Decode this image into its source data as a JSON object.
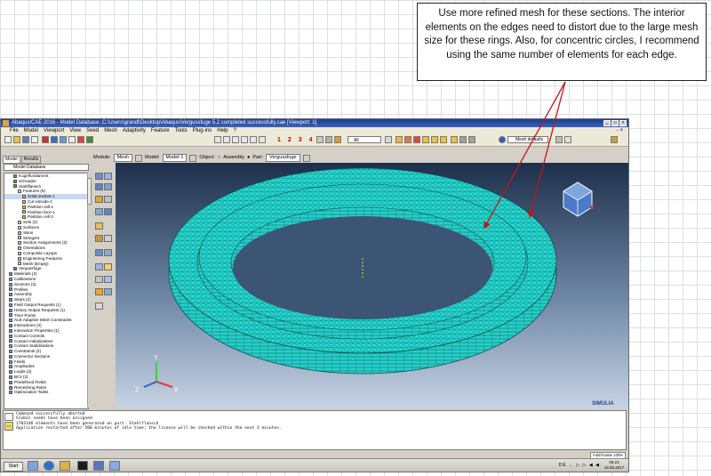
{
  "callout": {
    "text": "Use more refined mesh for these sections.  The interior elements on the edges need to distort due to the large mesh size for these rings.  Also, for concentric circles, I recommend using the same number of elements for each edge."
  },
  "window": {
    "title": "Abaqus/CAE 2016 - Model Database: C:\\Users\\grandl\\Desktop\\Abaqus\\Vergussfuge 5.2 completed successfully.cae [Viewport: 1]",
    "menu": [
      "File",
      "Model",
      "Viewport",
      "View",
      "Seed",
      "Mesh",
      "Adaptivity",
      "Feature",
      "Tools",
      "Plug-ins",
      "Help",
      "?"
    ],
    "right_glyphs": "- ×"
  },
  "toolbar": {
    "view_numbers": [
      "1",
      "2",
      "3",
      "4"
    ],
    "zoom_value": "All",
    "mesh_defaults": "Mesh defaults"
  },
  "tabs": [
    "Model",
    "Results"
  ],
  "module_bar": {
    "module_label": "Module:",
    "module_value": "Mesh",
    "model_label": "Model:",
    "model_value": "Model-1",
    "object_label": "Object:",
    "assembly_label": "Assembly",
    "part_label": "Part:",
    "part_value": "Vergussfuge"
  },
  "model_database": "Model Database",
  "tree": [
    {
      "label": "Kugelfundament",
      "level": 2
    },
    {
      "label": "Schraube",
      "level": 2
    },
    {
      "label": "Stahlflansch",
      "level": 2
    },
    {
      "label": "Features (5)",
      "level": 3
    },
    {
      "label": "Solid revolve-1",
      "level": 4,
      "selected": true
    },
    {
      "label": "Cut extrude-1",
      "level": 4
    },
    {
      "label": "Partition cell-1",
      "level": 4
    },
    {
      "label": "Partition face-1",
      "level": 4
    },
    {
      "label": "Partition cell-2",
      "level": 4
    },
    {
      "label": "Sets (2)",
      "level": 3
    },
    {
      "label": "Surfaces",
      "level": 3
    },
    {
      "label": "Skins",
      "level": 3
    },
    {
      "label": "Stringers",
      "level": 3
    },
    {
      "label": "Section Assignments (2)",
      "level": 3
    },
    {
      "label": "Orientations",
      "level": 3
    },
    {
      "label": "Composite Layups",
      "level": 3
    },
    {
      "label": "Engineering Features",
      "level": 3
    },
    {
      "label": "Mesh (Empty)",
      "level": 3
    },
    {
      "label": "Vergussfuge",
      "level": 2
    },
    {
      "label": "Materials (2)",
      "level": 1
    },
    {
      "label": "Calibrations",
      "level": 1
    },
    {
      "label": "Sections (3)",
      "level": 1
    },
    {
      "label": "Profiles",
      "level": 1
    },
    {
      "label": "Assembly",
      "level": 1
    },
    {
      "label": "Steps (2)",
      "level": 1
    },
    {
      "label": "Field Output Requests (1)",
      "level": 1
    },
    {
      "label": "History Output Requests (1)",
      "level": 1
    },
    {
      "label": "Time Points",
      "level": 1
    },
    {
      "label": "ALE Adaptive Mesh Constraints",
      "level": 1
    },
    {
      "label": "Interactions (3)",
      "level": 1
    },
    {
      "label": "Interaction Properties (1)",
      "level": 1
    },
    {
      "label": "Contact Controls",
      "level": 1
    },
    {
      "label": "Contact Initializations",
      "level": 1
    },
    {
      "label": "Contact Stabilizations",
      "level": 1
    },
    {
      "label": "Constraints (2)",
      "level": 1
    },
    {
      "label": "Connector Sections",
      "level": 1
    },
    {
      "label": "Fields",
      "level": 1
    },
    {
      "label": "Amplitudes",
      "level": 1
    },
    {
      "label": "Loads (2)",
      "level": 1
    },
    {
      "label": "BCs (2)",
      "level": 1
    },
    {
      "label": "Predefined Fields",
      "level": 1
    },
    {
      "label": "Remeshing Rules",
      "level": 1
    },
    {
      "label": "Optimization Tasks",
      "level": 1
    }
  ],
  "triad": {
    "x": "X",
    "y": "Y",
    "z": "Z"
  },
  "brand": "SIMULIA",
  "messages": [
    "Command successfully aborted",
    "Global seeds have been assigned",
    "1703146 elements have been generated on part: Stahlflansch",
    "Application restarted after 500 minutes of idle time; the license will be checked within the next 3 minutes."
  ],
  "status_right": "Fold:Fuss/e 100%",
  "taskbar": {
    "start": "Start",
    "tray": "DE ← ▷ ▷ ◀ ◀",
    "time": "09:23",
    "date": "18.05.2017"
  },
  "colors": {
    "mesh": "#27d9d2",
    "mesh_dark": "#0b6c6a",
    "arrow": "#c01818",
    "vp_top": "#1d2f4a",
    "vp_bottom": "#c7d3e3"
  }
}
